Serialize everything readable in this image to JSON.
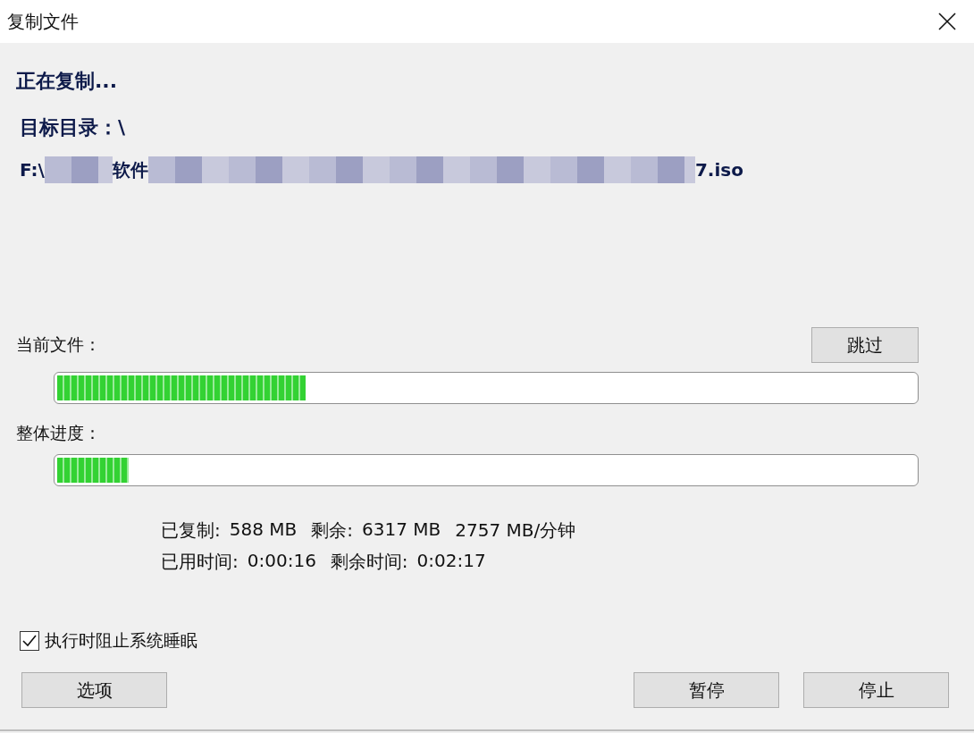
{
  "window": {
    "title": "复制文件"
  },
  "status": "正在复制...",
  "target": "目标目录：\\",
  "path": [
    {
      "kind": "text",
      "text": "F:\\"
    },
    {
      "kind": "blur"
    },
    {
      "kind": "text",
      "text": "软件"
    },
    {
      "kind": "blur"
    },
    {
      "kind": "text",
      "text": "7.iso"
    }
  ],
  "current_file": {
    "label": "当前文件：",
    "button": "跳过",
    "level": 0.29
  },
  "overall": {
    "label": "整体进度：",
    "level": 0.083
  },
  "stats": [
    [
      {
        "label": "已复制:",
        "value": "588 MB"
      },
      {
        "label": "剩余:",
        "value": "6317 MB"
      },
      {
        "value": "2757 MB/分钟"
      }
    ],
    [
      {
        "label": "已用时间:",
        "value": "0:00:16"
      },
      {
        "label": "剩余时间:",
        "value": "0:02:17"
      }
    ]
  ],
  "prevent_sleep": {
    "label": "执行时阻止系统睡眠",
    "checked": true
  },
  "buttons": {
    "options": "选项",
    "pause": "暂停",
    "stop": "停止"
  }
}
